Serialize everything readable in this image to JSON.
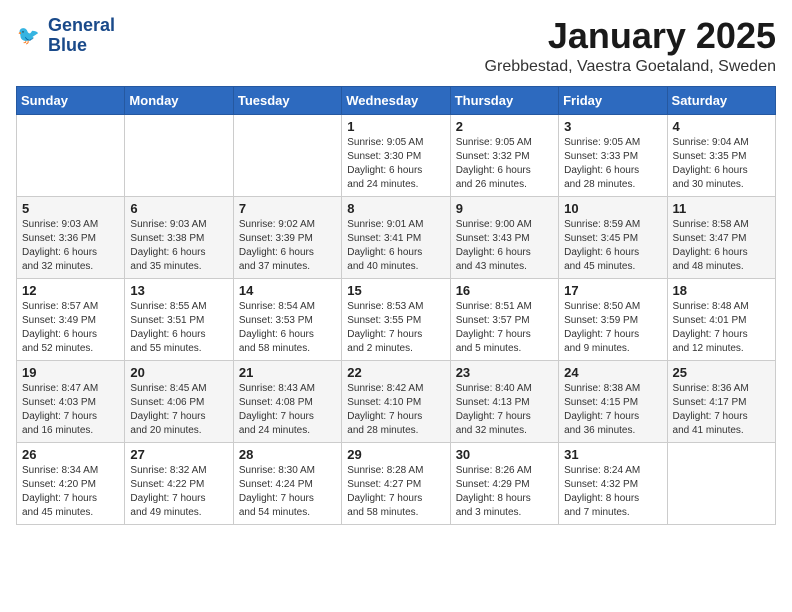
{
  "logo": {
    "line1": "General",
    "line2": "Blue"
  },
  "title": "January 2025",
  "location": "Grebbestad, Vaestra Goetaland, Sweden",
  "weekdays": [
    "Sunday",
    "Monday",
    "Tuesday",
    "Wednesday",
    "Thursday",
    "Friday",
    "Saturday"
  ],
  "weeks": [
    [
      {
        "day": "",
        "info": ""
      },
      {
        "day": "",
        "info": ""
      },
      {
        "day": "",
        "info": ""
      },
      {
        "day": "1",
        "info": "Sunrise: 9:05 AM\nSunset: 3:30 PM\nDaylight: 6 hours\nand 24 minutes."
      },
      {
        "day": "2",
        "info": "Sunrise: 9:05 AM\nSunset: 3:32 PM\nDaylight: 6 hours\nand 26 minutes."
      },
      {
        "day": "3",
        "info": "Sunrise: 9:05 AM\nSunset: 3:33 PM\nDaylight: 6 hours\nand 28 minutes."
      },
      {
        "day": "4",
        "info": "Sunrise: 9:04 AM\nSunset: 3:35 PM\nDaylight: 6 hours\nand 30 minutes."
      }
    ],
    [
      {
        "day": "5",
        "info": "Sunrise: 9:03 AM\nSunset: 3:36 PM\nDaylight: 6 hours\nand 32 minutes."
      },
      {
        "day": "6",
        "info": "Sunrise: 9:03 AM\nSunset: 3:38 PM\nDaylight: 6 hours\nand 35 minutes."
      },
      {
        "day": "7",
        "info": "Sunrise: 9:02 AM\nSunset: 3:39 PM\nDaylight: 6 hours\nand 37 minutes."
      },
      {
        "day": "8",
        "info": "Sunrise: 9:01 AM\nSunset: 3:41 PM\nDaylight: 6 hours\nand 40 minutes."
      },
      {
        "day": "9",
        "info": "Sunrise: 9:00 AM\nSunset: 3:43 PM\nDaylight: 6 hours\nand 43 minutes."
      },
      {
        "day": "10",
        "info": "Sunrise: 8:59 AM\nSunset: 3:45 PM\nDaylight: 6 hours\nand 45 minutes."
      },
      {
        "day": "11",
        "info": "Sunrise: 8:58 AM\nSunset: 3:47 PM\nDaylight: 6 hours\nand 48 minutes."
      }
    ],
    [
      {
        "day": "12",
        "info": "Sunrise: 8:57 AM\nSunset: 3:49 PM\nDaylight: 6 hours\nand 52 minutes."
      },
      {
        "day": "13",
        "info": "Sunrise: 8:55 AM\nSunset: 3:51 PM\nDaylight: 6 hours\nand 55 minutes."
      },
      {
        "day": "14",
        "info": "Sunrise: 8:54 AM\nSunset: 3:53 PM\nDaylight: 6 hours\nand 58 minutes."
      },
      {
        "day": "15",
        "info": "Sunrise: 8:53 AM\nSunset: 3:55 PM\nDaylight: 7 hours\nand 2 minutes."
      },
      {
        "day": "16",
        "info": "Sunrise: 8:51 AM\nSunset: 3:57 PM\nDaylight: 7 hours\nand 5 minutes."
      },
      {
        "day": "17",
        "info": "Sunrise: 8:50 AM\nSunset: 3:59 PM\nDaylight: 7 hours\nand 9 minutes."
      },
      {
        "day": "18",
        "info": "Sunrise: 8:48 AM\nSunset: 4:01 PM\nDaylight: 7 hours\nand 12 minutes."
      }
    ],
    [
      {
        "day": "19",
        "info": "Sunrise: 8:47 AM\nSunset: 4:03 PM\nDaylight: 7 hours\nand 16 minutes."
      },
      {
        "day": "20",
        "info": "Sunrise: 8:45 AM\nSunset: 4:06 PM\nDaylight: 7 hours\nand 20 minutes."
      },
      {
        "day": "21",
        "info": "Sunrise: 8:43 AM\nSunset: 4:08 PM\nDaylight: 7 hours\nand 24 minutes."
      },
      {
        "day": "22",
        "info": "Sunrise: 8:42 AM\nSunset: 4:10 PM\nDaylight: 7 hours\nand 28 minutes."
      },
      {
        "day": "23",
        "info": "Sunrise: 8:40 AM\nSunset: 4:13 PM\nDaylight: 7 hours\nand 32 minutes."
      },
      {
        "day": "24",
        "info": "Sunrise: 8:38 AM\nSunset: 4:15 PM\nDaylight: 7 hours\nand 36 minutes."
      },
      {
        "day": "25",
        "info": "Sunrise: 8:36 AM\nSunset: 4:17 PM\nDaylight: 7 hours\nand 41 minutes."
      }
    ],
    [
      {
        "day": "26",
        "info": "Sunrise: 8:34 AM\nSunset: 4:20 PM\nDaylight: 7 hours\nand 45 minutes."
      },
      {
        "day": "27",
        "info": "Sunrise: 8:32 AM\nSunset: 4:22 PM\nDaylight: 7 hours\nand 49 minutes."
      },
      {
        "day": "28",
        "info": "Sunrise: 8:30 AM\nSunset: 4:24 PM\nDaylight: 7 hours\nand 54 minutes."
      },
      {
        "day": "29",
        "info": "Sunrise: 8:28 AM\nSunset: 4:27 PM\nDaylight: 7 hours\nand 58 minutes."
      },
      {
        "day": "30",
        "info": "Sunrise: 8:26 AM\nSunset: 4:29 PM\nDaylight: 8 hours\nand 3 minutes."
      },
      {
        "day": "31",
        "info": "Sunrise: 8:24 AM\nSunset: 4:32 PM\nDaylight: 8 hours\nand 7 minutes."
      },
      {
        "day": "",
        "info": ""
      }
    ]
  ]
}
